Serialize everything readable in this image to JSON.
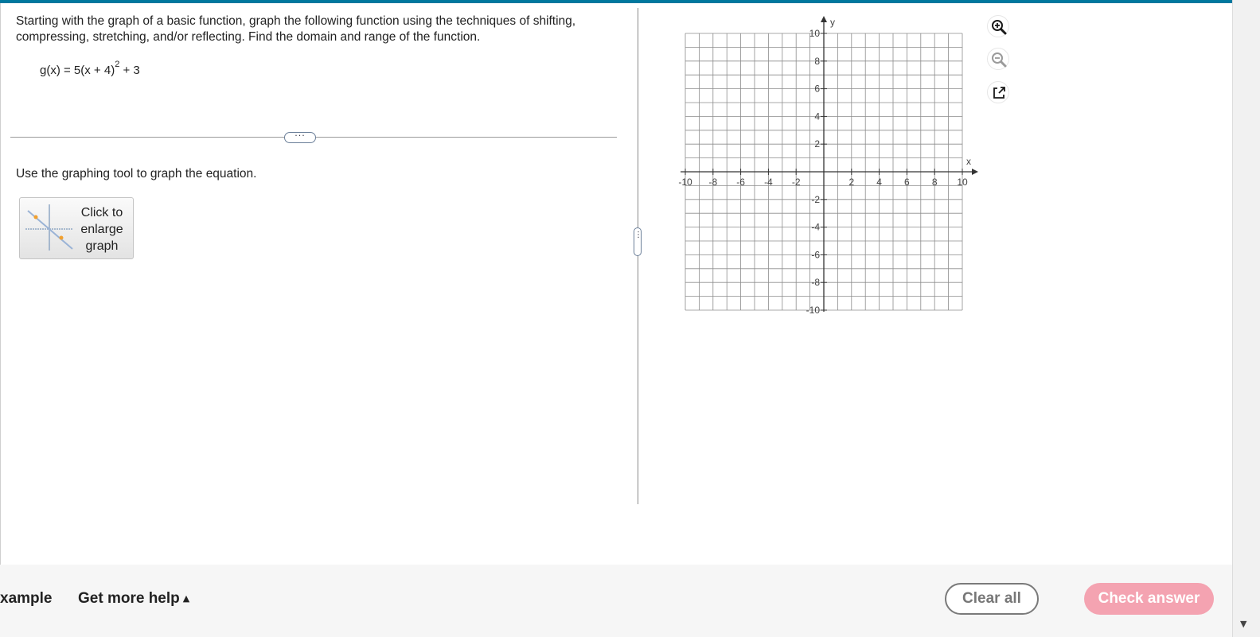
{
  "problem": {
    "instructions": "Starting with the graph of a basic function, graph the following function using the techniques of shifting, compressing, stretching, and/or reflecting. Find the domain and range of the function.",
    "equation_lhs": "g(x) = 5(x + 4)",
    "equation_exp": "2",
    "equation_rhs": " + 3"
  },
  "divider": {
    "handle": "···"
  },
  "left_panel": {
    "instruction": "Use the graphing tool to graph the equation.",
    "enlarge_line1": "Click to",
    "enlarge_line2": "enlarge",
    "enlarge_line3": "graph"
  },
  "graph": {
    "x_axis_label": "x",
    "y_axis_label": "y",
    "x_ticks": [
      "-10",
      "-8",
      "-6",
      "-4",
      "-2",
      "2",
      "4",
      "6",
      "8",
      "10"
    ],
    "y_ticks": [
      "10",
      "8",
      "6",
      "4",
      "2",
      "-2",
      "-4",
      "-6",
      "-8",
      "-10"
    ],
    "range": [
      -10,
      10
    ]
  },
  "tools": {
    "zoom_in": "zoom-in-icon",
    "zoom_out": "zoom-out-icon",
    "popout": "external-link-icon"
  },
  "bottom": {
    "example": "xample",
    "more_help": "Get more help",
    "clear_all": "Clear all",
    "check_answer": "Check answer"
  },
  "colors": {
    "top_bar": "#00789e",
    "check_answer_bg": "#f4a3b1"
  }
}
